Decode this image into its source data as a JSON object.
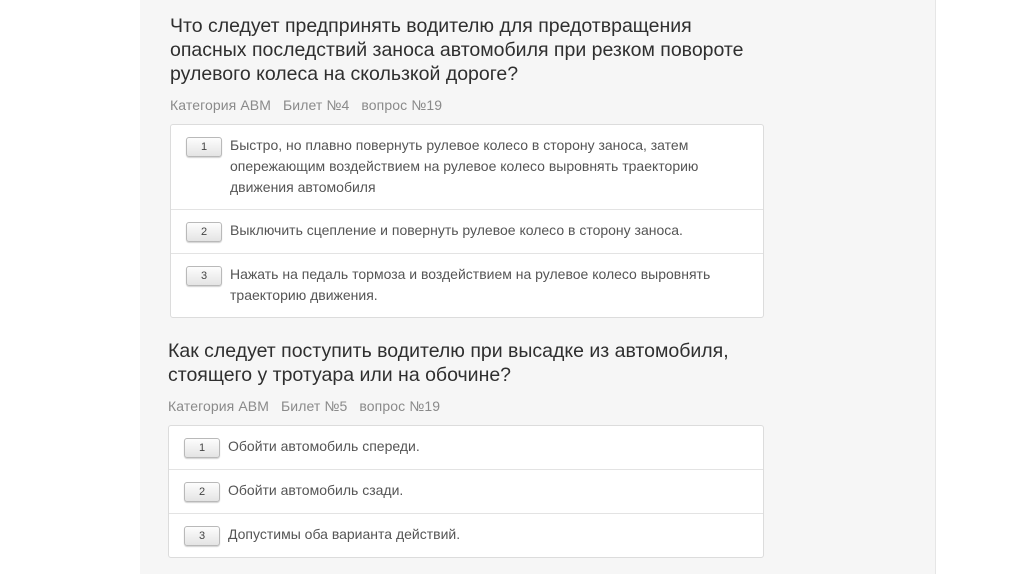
{
  "questions": [
    {
      "title": "Что следует предпринять водителю для предотвращения опасных последствий заноса автомобиля при резком повороте рулевого колеса на скользкой дороге?",
      "category": "Категория ABM",
      "ticket": "Билет №4",
      "question_no": "вопрос №19",
      "answers": [
        {
          "num": "1",
          "text": "Быстро, но плавно повернуть рулевое колесо в сторону заноса, затем опережающим воздействием на рулевое колесо выровнять траекторию движения автомобиля"
        },
        {
          "num": "2",
          "text": "Выключить сцепление и повернуть рулевое колесо в сторону заноса."
        },
        {
          "num": "3",
          "text": "Нажать на педаль тормоза и воздействием на рулевое колесо выровнять траекторию движения."
        }
      ]
    },
    {
      "title": "Как следует поступить водителю при высадке из автомобиля, стоящего у тротуара или на обочине?",
      "category": "Категория ABM",
      "ticket": "Билет №5",
      "question_no": "вопрос №19",
      "answers": [
        {
          "num": "1",
          "text": "Обойти автомобиль спереди."
        },
        {
          "num": "2",
          "text": "Обойти автомобиль сзади."
        },
        {
          "num": "3",
          "text": "Допустимы оба варианта действий."
        }
      ]
    }
  ]
}
